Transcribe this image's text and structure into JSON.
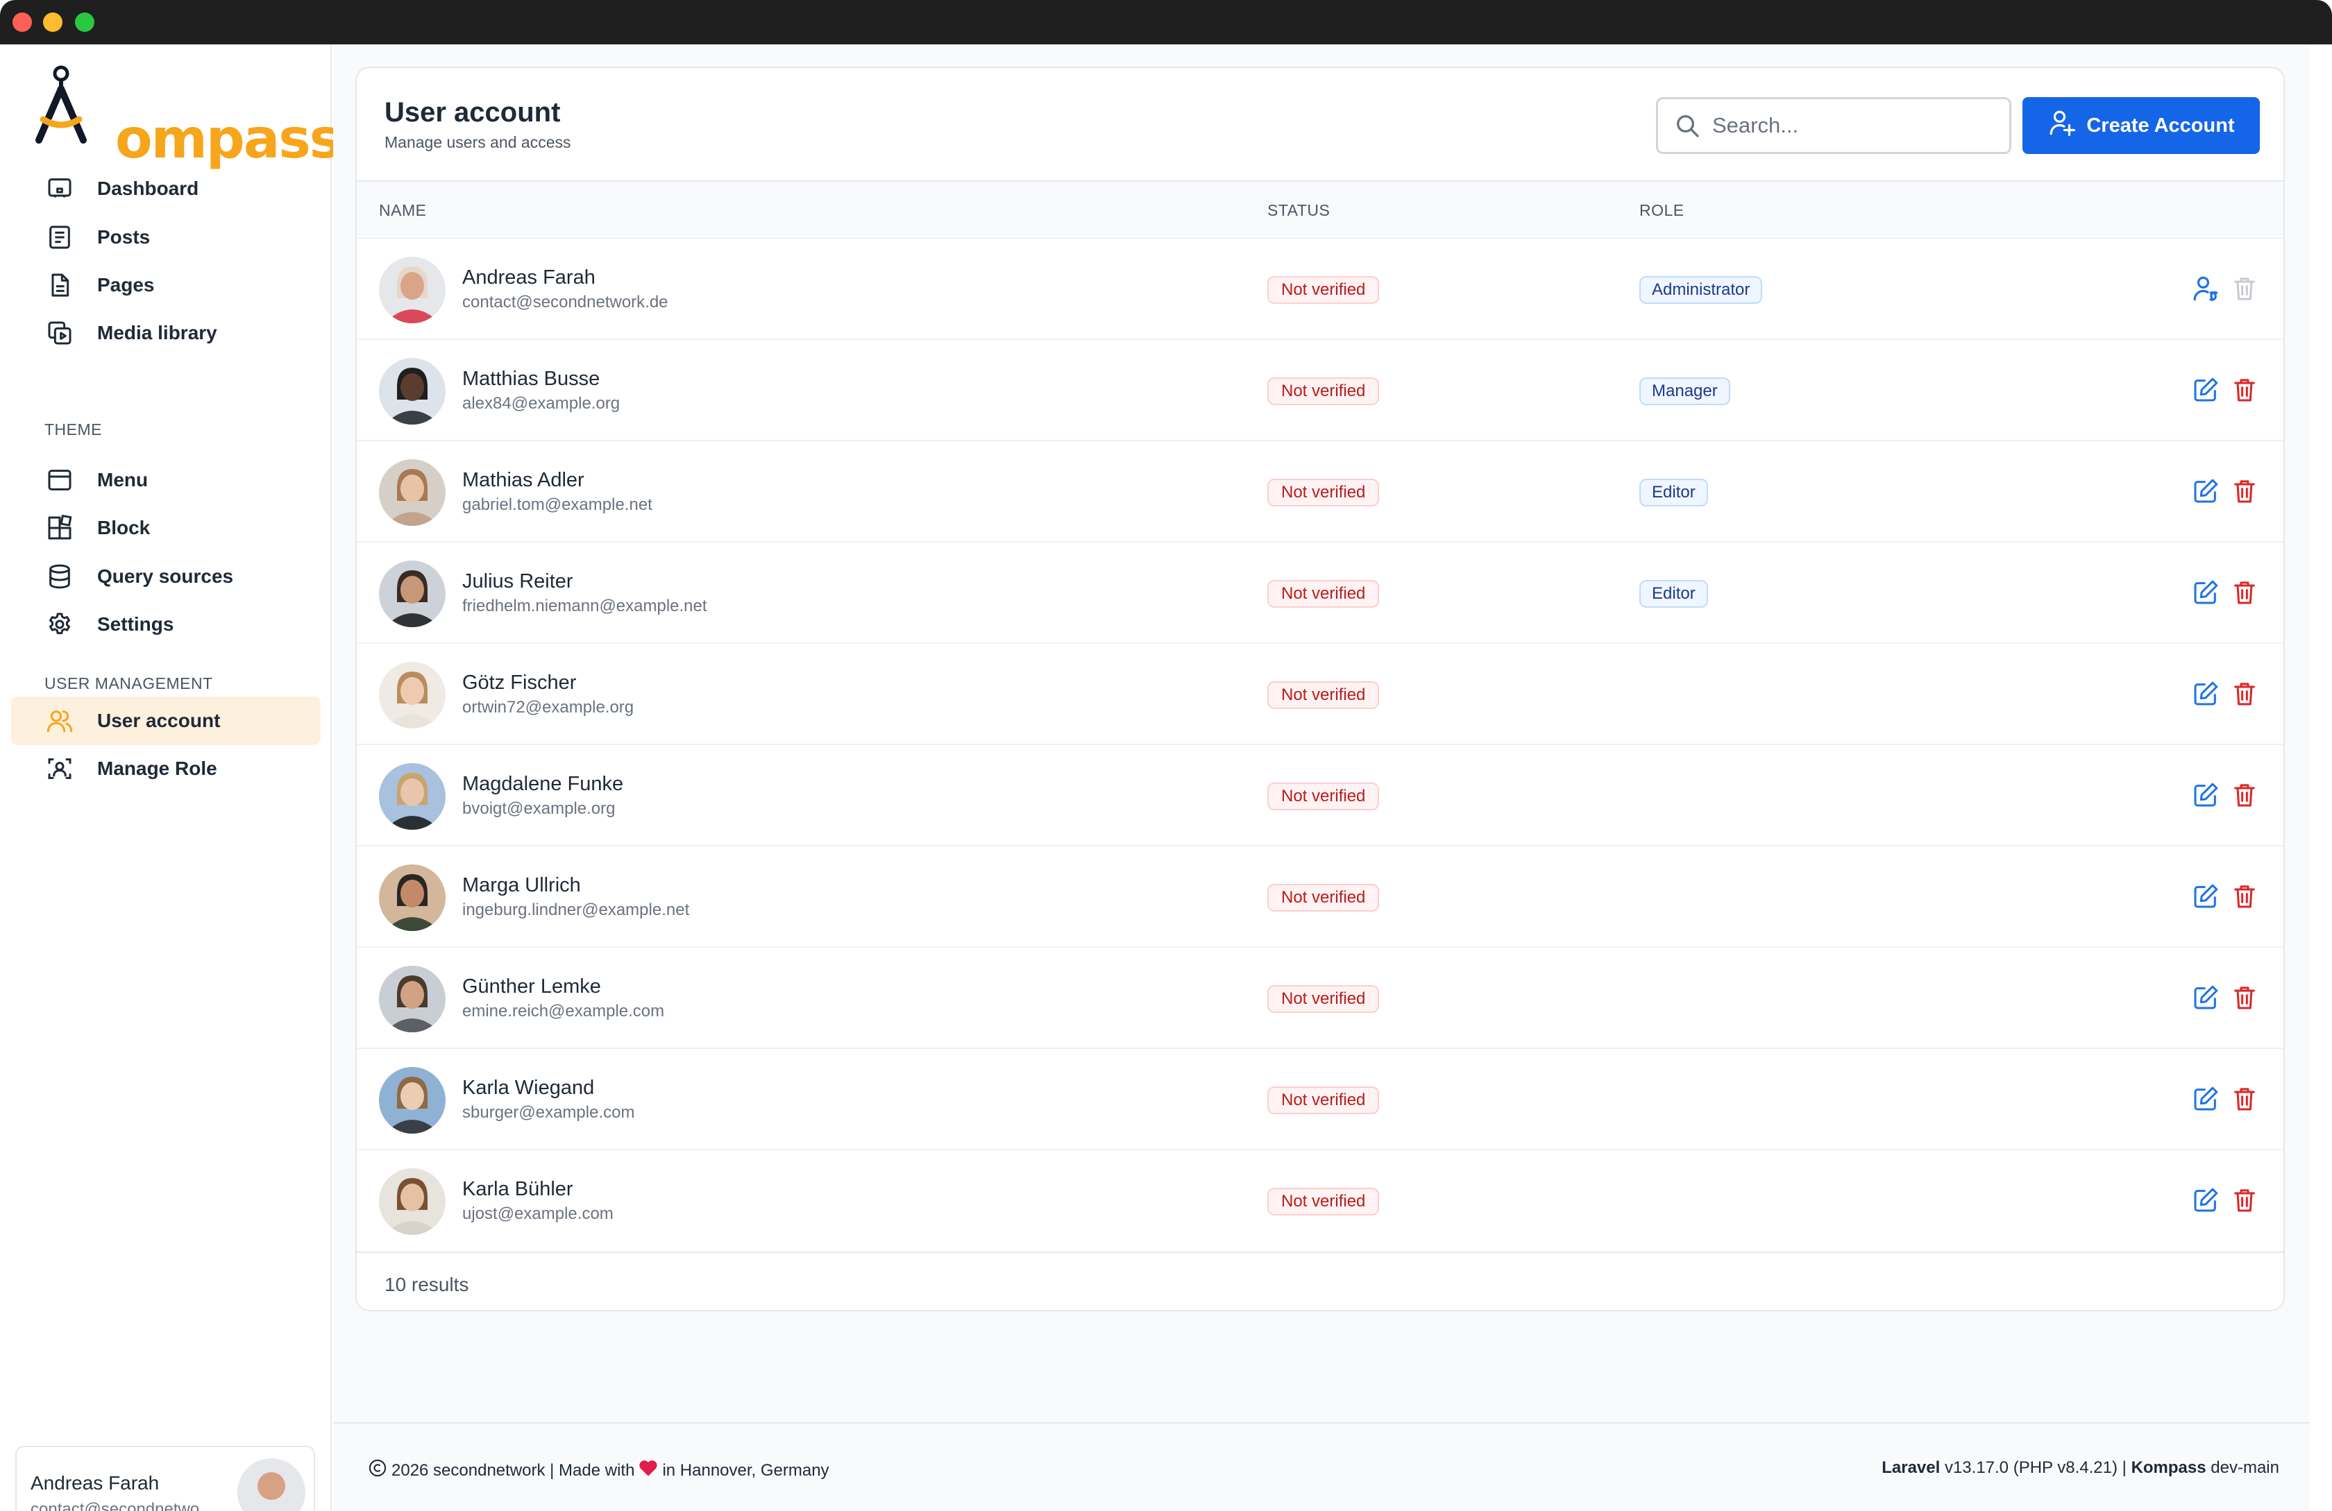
{
  "sidebar": {
    "logo_text": "ompass",
    "nav": [
      {
        "label": "Dashboard",
        "icon": "dashboard-icon"
      },
      {
        "label": "Posts",
        "icon": "posts-icon"
      },
      {
        "label": "Pages",
        "icon": "pages-icon"
      },
      {
        "label": "Media library",
        "icon": "media-library-icon"
      }
    ],
    "theme_section": "THEME",
    "theme_nav": [
      {
        "label": "Menu",
        "icon": "menu-icon"
      },
      {
        "label": "Block",
        "icon": "block-icon"
      },
      {
        "label": "Query sources",
        "icon": "database-icon"
      },
      {
        "label": "Settings",
        "icon": "gear-icon"
      }
    ],
    "user_section": "USER MANAGEMENT",
    "user_nav": [
      {
        "label": "User account",
        "icon": "users-icon",
        "active": true
      },
      {
        "label": "Manage Role",
        "icon": "role-icon"
      }
    ],
    "current_user": {
      "name": "Andreas Farah",
      "email": "contact@secondnetwo..."
    }
  },
  "main": {
    "title": "User account",
    "subtitle": "Manage users and access",
    "search_placeholder": "Search...",
    "create_button": "Create Account",
    "columns": {
      "name": "NAME",
      "status": "STATUS",
      "role": "ROLE"
    },
    "users": [
      {
        "name": "Andreas Farah",
        "email": "contact@secondnetwork.de",
        "status": "Not verified",
        "role": "Administrator",
        "self": true
      },
      {
        "name": "Matthias Busse",
        "email": "alex84@example.org",
        "status": "Not verified",
        "role": "Manager"
      },
      {
        "name": "Mathias Adler",
        "email": "gabriel.tom@example.net",
        "status": "Not verified",
        "role": "Editor"
      },
      {
        "name": "Julius Reiter",
        "email": "friedhelm.niemann@example.net",
        "status": "Not verified",
        "role": "Editor"
      },
      {
        "name": "Götz Fischer",
        "email": "ortwin72@example.org",
        "status": "Not verified",
        "role": ""
      },
      {
        "name": "Magdalene Funke",
        "email": "bvoigt@example.org",
        "status": "Not verified",
        "role": ""
      },
      {
        "name": "Marga Ullrich",
        "email": "ingeburg.lindner@example.net",
        "status": "Not verified",
        "role": ""
      },
      {
        "name": "Günther Lemke",
        "email": "emine.reich@example.com",
        "status": "Not verified",
        "role": ""
      },
      {
        "name": "Karla Wiegand",
        "email": "sburger@example.com",
        "status": "Not verified",
        "role": ""
      },
      {
        "name": "Karla Bühler",
        "email": "ujost@example.com",
        "status": "Not verified",
        "role": ""
      }
    ],
    "results": "10 results"
  },
  "footer": {
    "copyright": "2026 secondnetwork | Made with",
    "location": "in Hannover, Germany",
    "laravel_label": "Laravel",
    "laravel_version": "v13.17.0 (PHP v8.4.21) |",
    "kompass_label": "Kompass",
    "kompass_version": "dev-main"
  },
  "colors": {
    "accent": "#1565e8",
    "brand": "#f7a51b",
    "status_bg": "#fef2f2",
    "status_text": "#b91c1c",
    "role_bg": "#eff6ff",
    "delete": "#dc2626"
  }
}
